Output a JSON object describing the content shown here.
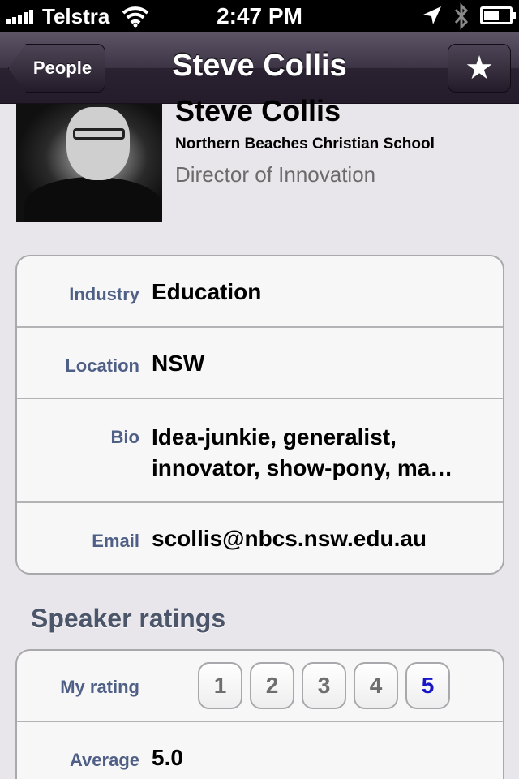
{
  "status_bar": {
    "carrier": "Telstra",
    "time": "2:47 PM"
  },
  "nav": {
    "back_label": "People",
    "title": "Steve Collis"
  },
  "profile": {
    "name": "Steve Collis",
    "organization": "Northern Beaches Christian School",
    "role": "Director of Innovation"
  },
  "info": {
    "rows": [
      {
        "label": "Industry",
        "value": "Education"
      },
      {
        "label": "Location",
        "value": "NSW"
      },
      {
        "label": "Bio",
        "value": "Idea-junkie, generalist, innovator, show-pony, ma…"
      },
      {
        "label": "Email",
        "value": "scollis@nbcs.nsw.edu.au"
      }
    ]
  },
  "ratings": {
    "section_title": "Speaker ratings",
    "my_rating_label": "My rating",
    "options": [
      "1",
      "2",
      "3",
      "4",
      "5"
    ],
    "selected": "5",
    "average_label": "Average",
    "average_value": "5.0",
    "selected_color": "#1616c8"
  }
}
